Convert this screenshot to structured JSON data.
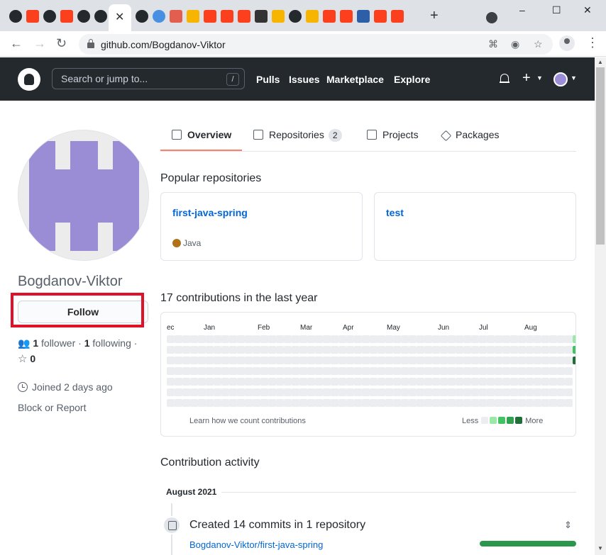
{
  "browser": {
    "url": "github.com/Bogdanov-Viktor",
    "tab_close_glyph": "✕",
    "new_tab_glyph": "+",
    "window_buttons": [
      "–",
      "☐",
      "✕"
    ],
    "tab_favicons": [
      "github-icon",
      "yandex-icon",
      "github-icon",
      "yandex-icon",
      "github-icon",
      "github-icon",
      "active",
      "github-icon",
      "world-icon",
      "browser-icon",
      "mail-icon",
      "yandex-icon",
      "yandex-icon",
      "yandex-icon",
      "app-icon",
      "mail-icon",
      "github-icon",
      "mail-icon",
      "yandex-icon",
      "yandex-icon",
      "book-icon",
      "yandex-icon",
      "yandex-icon"
    ]
  },
  "header": {
    "search_placeholder": "Search or jump to...",
    "slash_key": "/",
    "nav": [
      "Pulls",
      "Issues",
      "Marketplace",
      "Explore"
    ]
  },
  "profile": {
    "username": "Bogdanov-Viktor",
    "follow_label": "Follow",
    "followers_count": "1",
    "followers_label": "follower",
    "following_count": "1",
    "following_label": "following",
    "stars_count": "0",
    "joined": "Joined 2 days ago",
    "block_report": "Block or Report"
  },
  "tabs": [
    {
      "label": "Overview",
      "active": true
    },
    {
      "label": "Repositories",
      "count": "2"
    },
    {
      "label": "Projects"
    },
    {
      "label": "Packages"
    }
  ],
  "popular": {
    "title": "Popular repositories",
    "repos": [
      {
        "name": "first-java-spring",
        "language": "Java",
        "language_color": "#b07219"
      },
      {
        "name": "test",
        "language": ""
      }
    ]
  },
  "contributions": {
    "title": "17 contributions in the last year",
    "months": [
      "ec",
      "Jan",
      "Feb",
      "Mar",
      "Apr",
      "May",
      "Jun",
      "Jul",
      "Aug"
    ],
    "learn_link": "Learn how we count contributions",
    "legend_less": "Less",
    "legend_more": "More",
    "legend_colors": [
      "#ebedf0",
      "#9be9a8",
      "#40c463",
      "#30a14e",
      "#216e39"
    ],
    "active_days": [
      {
        "week": 52,
        "day": 0,
        "color": "#9be9a8"
      },
      {
        "week": 52,
        "day": 1,
        "color": "#40c463"
      },
      {
        "week": 52,
        "day": 2,
        "color": "#216e39"
      }
    ]
  },
  "activity": {
    "title": "Contribution activity",
    "month": "August 2021",
    "summary": "Created 14 commits in 1 repository",
    "repo": "Bogdanov-Viktor/first-java-spring",
    "progress": 1.0
  }
}
